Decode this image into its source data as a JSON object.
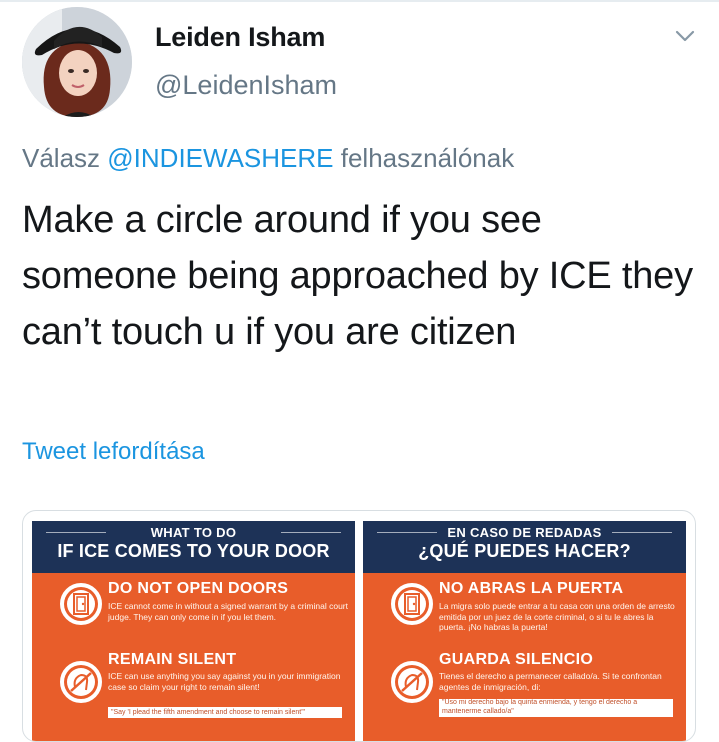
{
  "user": {
    "display_name": "Leiden Isham",
    "handle": "@LeidenIsham"
  },
  "reply": {
    "prefix": "Válasz",
    "mention": "@INDIEWASHERE",
    "suffix": "felhasználónak"
  },
  "tweet": {
    "text": "Make a circle around if you see someone being approached by ICE they can’t touch u if you are citizen",
    "translate_link": "Tweet lefordítása"
  },
  "icons": {
    "more_menu": "chevron-down-icon",
    "door": "door-icon",
    "silent": "no-speaking-icon"
  },
  "colors": {
    "link": "#1b95e0",
    "flyer_orange": "#e85d2a",
    "flyer_navy": "#1d3257"
  },
  "flyer": {
    "left": {
      "subtitle": "WHAT TO DO",
      "title": "IF ICE COMES TO YOUR DOOR",
      "item1_title": "DO NOT OPEN DOORS",
      "item1_body": "ICE cannot come in without a signed warrant by a criminal court judge. They can only come in if you let them.",
      "item2_title": "REMAIN SILENT",
      "item2_body": "ICE can use anything you say against you in your immigration case so claim your right to remain silent!",
      "item2_note": "\"Say 'I plead the fifth amendment and choose to remain silent'\""
    },
    "right": {
      "subtitle": "EN CASO DE REDADAS",
      "title": "¿QUÉ PUEDES HACER?",
      "item1_title": "NO ABRAS LA PUERTA",
      "item1_body": "La migra solo puede entrar a tu casa con una orden de arresto emitida por un juez de la corte criminal, o si tu le abres la puerta. ¡No habras la puerta!",
      "item2_title": "GUARDA SILENCIO",
      "item2_body": "Tienes el derecho a permanecer callado/a. Si te confrontan agentes de inmigración, di:",
      "item2_note": "\"Uso mi derecho bajo la quinta enmienda, y tengo el derecho a mantenerme callado/a\""
    }
  }
}
